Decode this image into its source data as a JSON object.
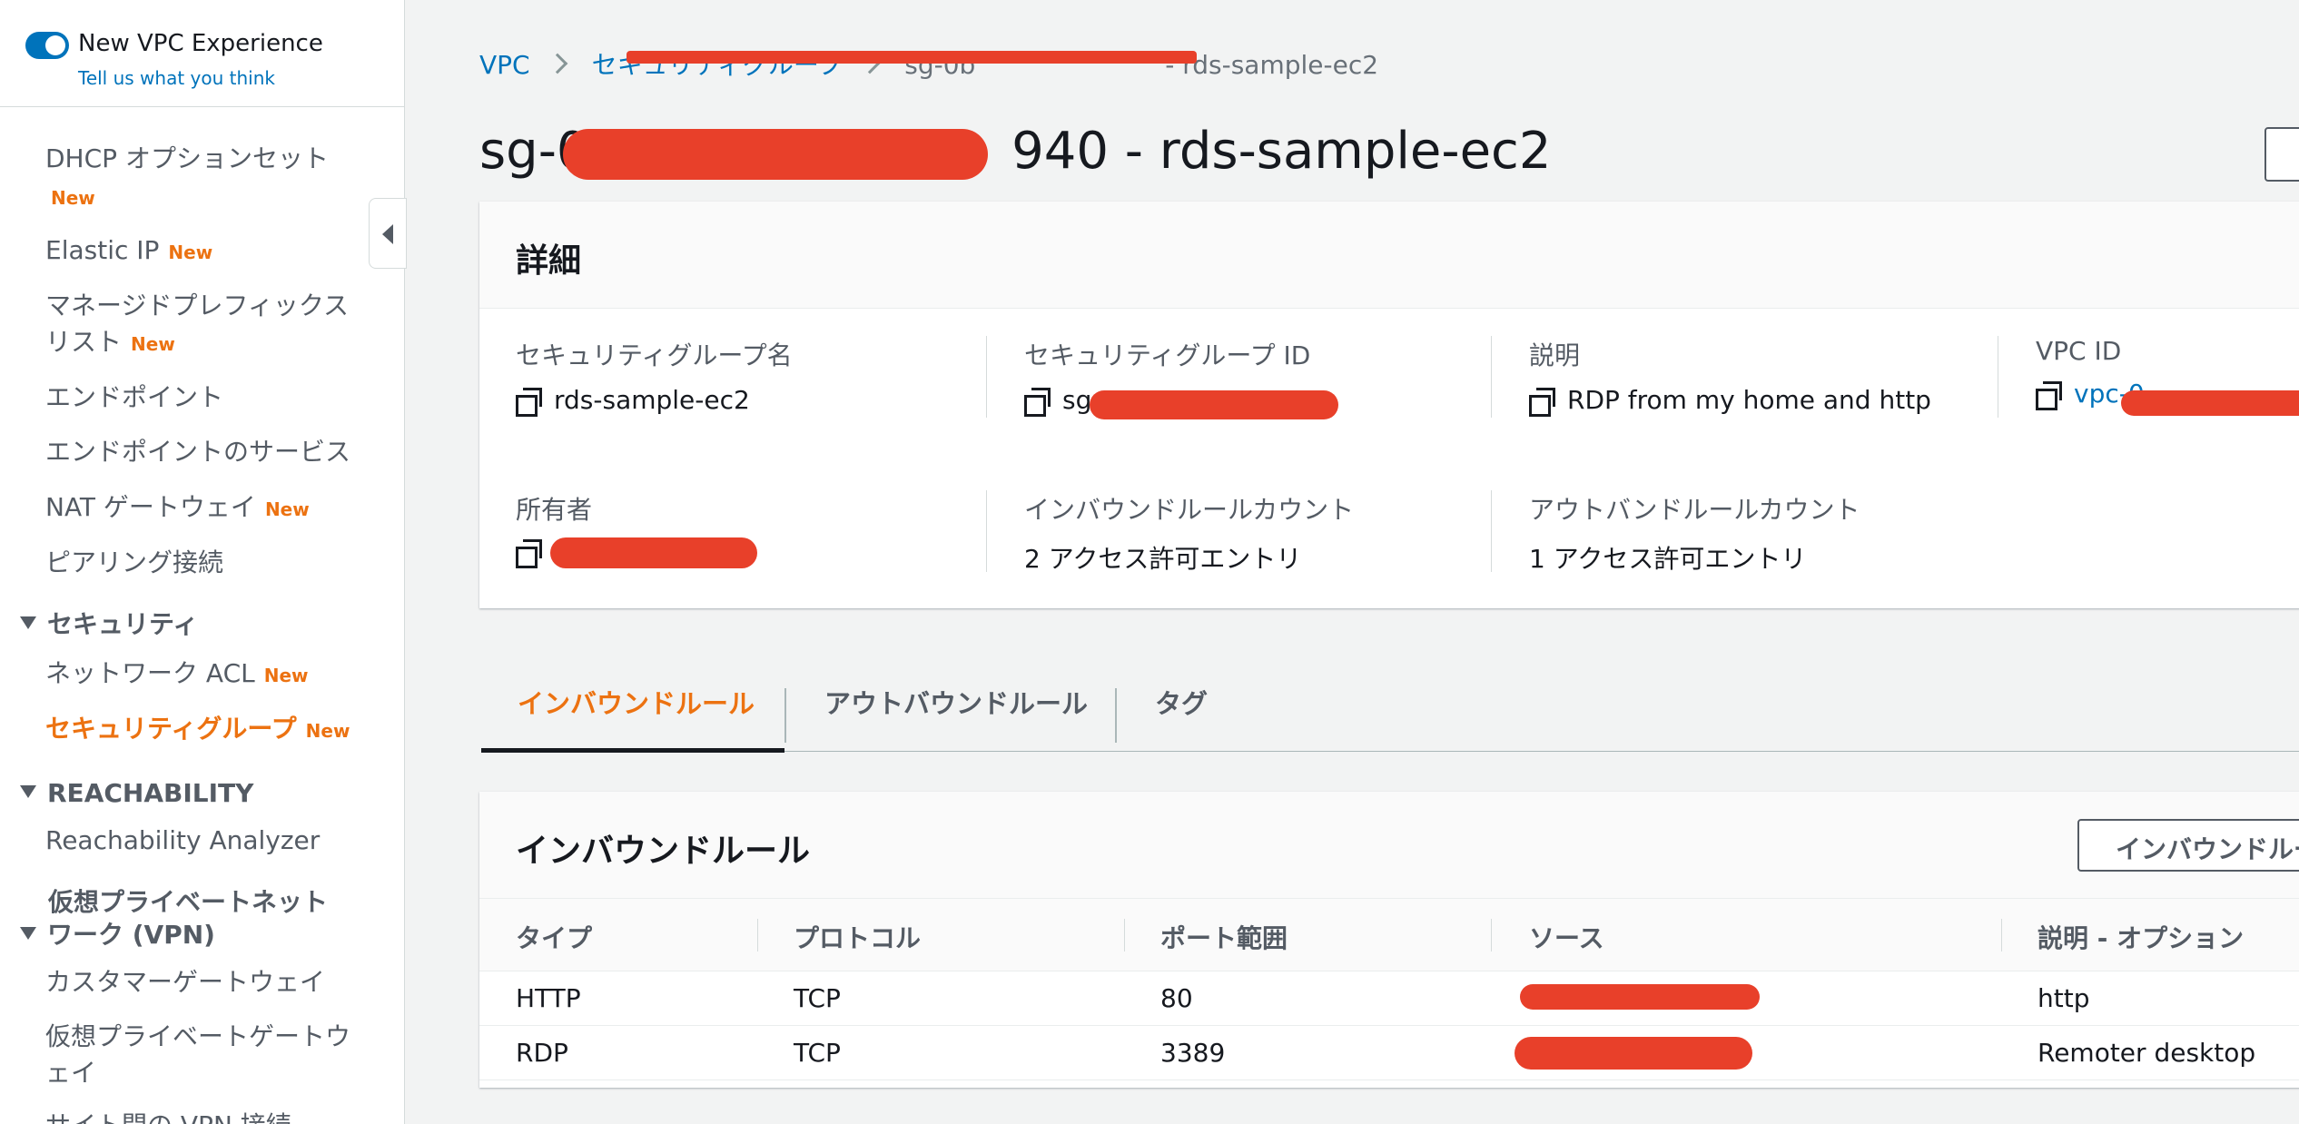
{
  "sidebar": {
    "new_vpc_title": "New VPC Experience",
    "new_vpc_feedback": "Tell us what you think",
    "new_badge": "New",
    "items": [
      {
        "label": "DHCP オプションセット"
      },
      {
        "label": "Elastic IP"
      },
      {
        "label": "マネージドプレフィックス"
      },
      {
        "label": "リスト"
      },
      {
        "label": "エンドポイント"
      },
      {
        "label": "エンドポイントのサービス"
      },
      {
        "label": "NAT ゲートウェイ"
      },
      {
        "label": "ピアリング接続"
      }
    ],
    "sections": {
      "security": {
        "title": "セキュリティ",
        "items": [
          {
            "label": "ネットワーク ACL"
          },
          {
            "label": "セキュリティグループ"
          }
        ]
      },
      "reachability": {
        "title": "REACHABILITY",
        "items": [
          {
            "label": "Reachability Analyzer"
          }
        ]
      },
      "vpn": {
        "title_line1": "仮想プライベートネット",
        "title_line2": "ワーク (VPN)",
        "items": [
          {
            "label": "カスタマーゲートウェイ"
          },
          {
            "label": "仮想プライベートゲートウ"
          },
          {
            "label": "ェイ"
          },
          {
            "label": "サイト間の VPN 接続"
          }
        ]
      }
    }
  },
  "breadcrumb": {
    "vpc": "VPC",
    "security_groups": "セキュリティグループ",
    "current_prefix": "sg-0b",
    "current_suffix": " - rds-sample-ec2"
  },
  "page": {
    "title_prefix": "sg-0b",
    "title_suffix": "940 - rds-sample-ec2"
  },
  "details": {
    "heading": "詳細",
    "sg_name_label": "セキュリティグループ名",
    "sg_name_value": "rds-sample-ec2",
    "sg_id_label": "セキュリティグループ ID",
    "sg_id_value": "sg-",
    "desc_label": "説明",
    "desc_value": "RDP from my home and http",
    "vpc_id_label": "VPC ID",
    "vpc_id_value": "vpc-0",
    "owner_label": "所有者",
    "inbound_count_label": "インバウンドルールカウント",
    "inbound_count_value": "2 アクセス許可エントリ",
    "outbound_count_label": "アウトバンドルールカウント",
    "outbound_count_value": "1 アクセス許可エントリ"
  },
  "tabs": [
    {
      "label": "インバウンドルール"
    },
    {
      "label": "アウトバウンドルール"
    },
    {
      "label": "タグ"
    }
  ],
  "inbound": {
    "heading": "インバウンドルール",
    "edit_button": "インバウンドルールを編集",
    "columns": [
      "タイプ",
      "プロトコル",
      "ポート範囲",
      "ソース",
      "説明 - オプション"
    ],
    "rows": [
      {
        "type": "HTTP",
        "protocol": "TCP",
        "port": "80",
        "description": "http"
      },
      {
        "type": "RDP",
        "protocol": "TCP",
        "port": "3389",
        "description": "Remoter desktop"
      }
    ]
  },
  "colors": {
    "accent": "#ec7211",
    "link": "#0073bb",
    "redaction": "#e8402a"
  }
}
